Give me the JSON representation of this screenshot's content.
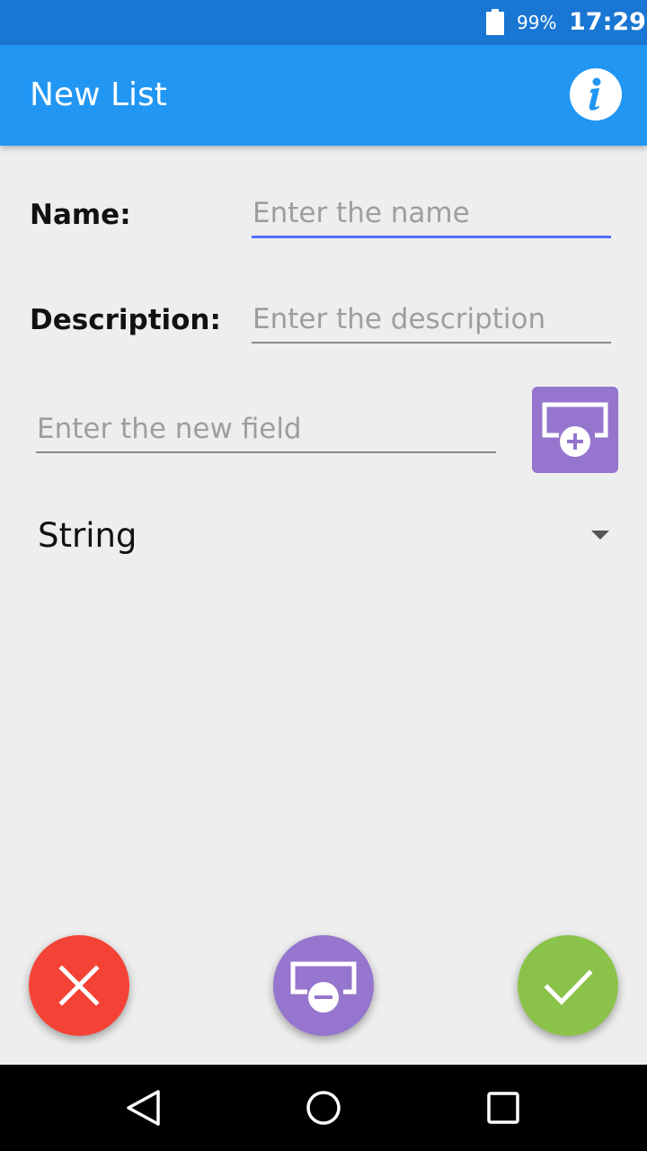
{
  "status_bar": {
    "battery_icon": "battery-full-icon",
    "battery_percent": "99%",
    "time": "17:29"
  },
  "app_bar": {
    "title": "New List",
    "info_icon": "info-icon"
  },
  "form": {
    "name_label": "Name:",
    "name_value": "",
    "name_placeholder": "Enter the name",
    "description_label": "Description:",
    "description_value": "",
    "description_placeholder": "Enter the description",
    "new_field_value": "",
    "new_field_placeholder": "Enter the new field",
    "add_field_icon": "add-field-icon",
    "type_selected": "String"
  },
  "actions": {
    "cancel_icon": "close-icon",
    "remove_field_icon": "remove-field-icon",
    "confirm_icon": "check-icon"
  },
  "nav": {
    "back_icon": "back-triangle-icon",
    "home_icon": "home-circle-icon",
    "recents_icon": "recents-square-icon"
  },
  "colors": {
    "status_bar": "#1976d2",
    "app_bar": "#2196f3",
    "accent_focus": "#536dfe",
    "purple": "#9575cd",
    "cancel_red": "#f44336",
    "confirm_green": "#8bc34a"
  }
}
